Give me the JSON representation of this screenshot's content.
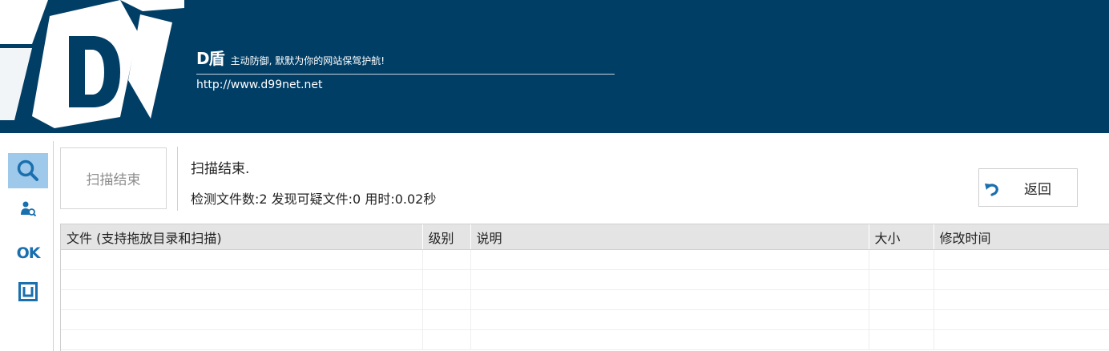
{
  "header": {
    "logo_letter": "D",
    "brand_name": "D盾",
    "slogan": "主动防御, 默默为你的网站保驾护航!",
    "url": "http://www.d99net.net"
  },
  "toolbar": {
    "items": [
      {
        "icon": "search-icon",
        "active": true
      },
      {
        "icon": "user-scan-icon",
        "active": false
      },
      {
        "icon": "ok-icon",
        "label": "OK",
        "active": false
      },
      {
        "icon": "square-box-icon",
        "active": false
      }
    ]
  },
  "scan": {
    "button_label": "扫描结束",
    "status_title": "扫描结束.",
    "status_detail": "检测文件数:2 发现可疑文件:0 用时:0.02秒"
  },
  "back_button": {
    "label": "返回",
    "icon": "undo-icon"
  },
  "table": {
    "columns": [
      "文件 (支持拖放目录和扫描)",
      "级别",
      "说明",
      "大小",
      "修改时间"
    ],
    "rows": []
  },
  "colors": {
    "banner_bg": "#003e66",
    "active_tool_bg": "#9ec9ea",
    "icon_blue": "#1a6fae",
    "header_row_bg": "#e4e4e4"
  }
}
